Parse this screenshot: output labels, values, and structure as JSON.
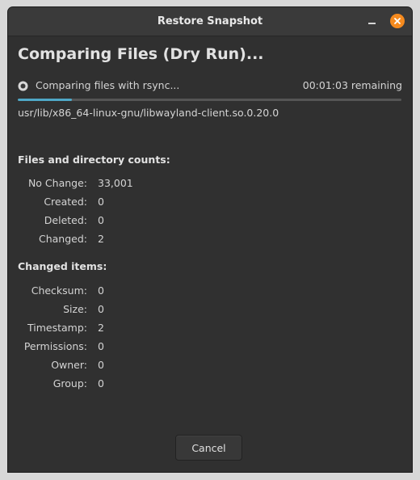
{
  "window": {
    "title": "Restore Snapshot"
  },
  "titlebar_buttons": {
    "minimize_icon": "minimize-icon",
    "close_icon": "close-icon",
    "close_color": "#f58a1e"
  },
  "heading": "Comparing Files (Dry Run)...",
  "status": {
    "text": "Comparing files with rsync...",
    "remaining": "00:01:03 remaining",
    "progress_fraction": 0.14,
    "progress_color": "#4fa8c7"
  },
  "current_file": "usr/lib/x86_64-linux-gnu/libwayland-client.so.0.20.0",
  "file_counts": {
    "title": "Files and directory counts:",
    "rows": [
      {
        "label": "No Change:",
        "value": "33,001"
      },
      {
        "label": "Created:",
        "value": "0"
      },
      {
        "label": "Deleted:",
        "value": "0"
      },
      {
        "label": "Changed:",
        "value": "2"
      }
    ]
  },
  "changed_items": {
    "title": "Changed items:",
    "rows": [
      {
        "label": "Checksum:",
        "value": "0"
      },
      {
        "label": "Size:",
        "value": "0"
      },
      {
        "label": "Timestamp:",
        "value": "2"
      },
      {
        "label": "Permissions:",
        "value": "0"
      },
      {
        "label": "Owner:",
        "value": "0"
      },
      {
        "label": "Group:",
        "value": "0"
      }
    ]
  },
  "footer": {
    "cancel_label": "Cancel"
  }
}
